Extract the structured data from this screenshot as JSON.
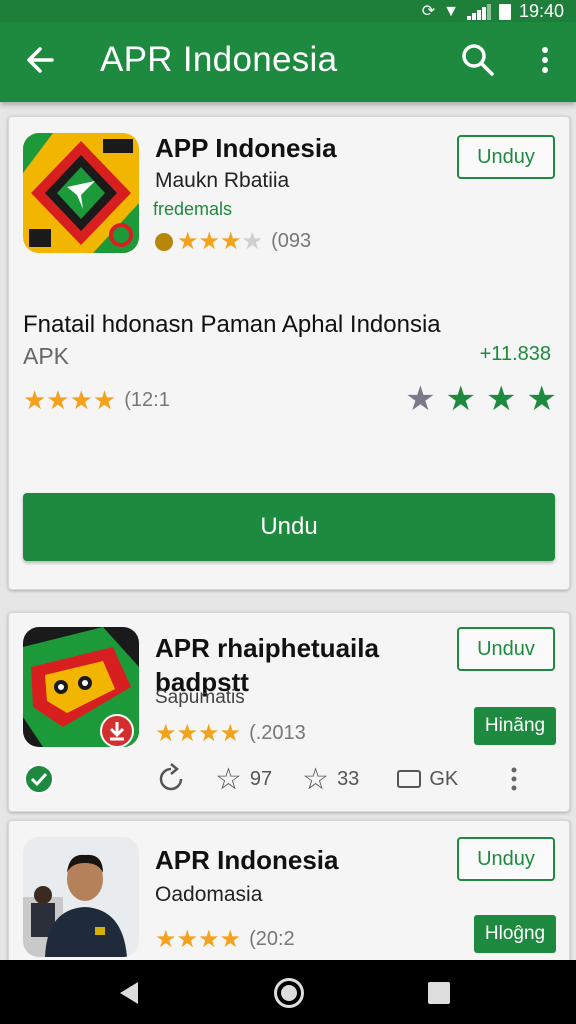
{
  "status_bar": {
    "time": "19:40"
  },
  "toolbar": {
    "title": "APR Indonesia"
  },
  "featured": {
    "title": "APP Indonesia",
    "subtitle": "Maukn Rbatiia",
    "developer": "fredemals",
    "rating_count": "(093",
    "install_label": "Unduy",
    "description": "Fnatail hdonasn Paman Aphal Indonsia",
    "type": "APK",
    "price": "+11.838",
    "rating_count_2": "(12:1",
    "download_label": "Undu"
  },
  "app2": {
    "title": "APR rhaiphetuaila",
    "title_line2": "badpstt",
    "subtitle": "Sapumatis",
    "rating_count": "(.2013",
    "install_label": "Unduv",
    "secondary_label": "Hinãng",
    "actions": {
      "star_count_1": "97",
      "star_count_2": "33",
      "size": "GK"
    }
  },
  "app3": {
    "title": "APR Indonesia",
    "subtitle": "Oadomasia",
    "rating_count": "(20:2",
    "install_label": "Unduy",
    "secondary_label": "Hloĝng"
  },
  "colors": {
    "accent": "#1e8a3f",
    "star": "#f4a21c"
  }
}
